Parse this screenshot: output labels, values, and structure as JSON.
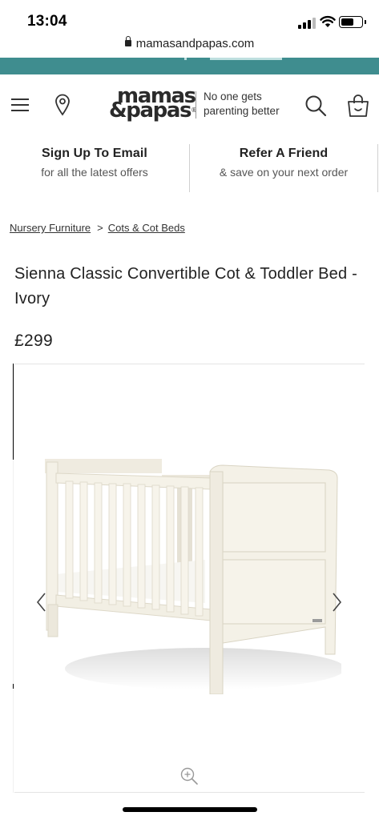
{
  "status_bar": {
    "time": "13:04",
    "icons": [
      "signal-icon",
      "wifi-icon",
      "battery-icon"
    ]
  },
  "browser": {
    "url": "mamasandpapas.com",
    "lock_icon": "lock-icon"
  },
  "header": {
    "logo_line1": "mamas",
    "logo_line2": "&papas",
    "logo_mark": "®",
    "tagline_line1": "No one gets",
    "tagline_line2": "parenting better",
    "icons": [
      "menu-icon",
      "location-pin-icon",
      "search-icon",
      "shopping-bag-icon"
    ]
  },
  "promos": [
    {
      "title": "Sign Up To Email",
      "subtitle": "for all the latest offers"
    },
    {
      "title": "Refer A Friend",
      "subtitle": "& save on your next order"
    }
  ],
  "breadcrumb": {
    "items": [
      "Nursery Furniture",
      "Cots & Cot Beds"
    ],
    "separator": ">"
  },
  "product": {
    "title_line1": "Sienna Classic Convertible Cot & Toddler Bed -",
    "title_line2": "Ivory",
    "price": "£299"
  },
  "gallery": {
    "image_name": "cot-product-image",
    "prev_icon": "chevron-left-icon",
    "next_icon": "chevron-right-icon",
    "zoom_icon": "zoom-in-icon"
  },
  "colors": {
    "promo_strip": "#3f8d8f",
    "text": "#222222",
    "cot_ivory": "#f3f0e6"
  }
}
